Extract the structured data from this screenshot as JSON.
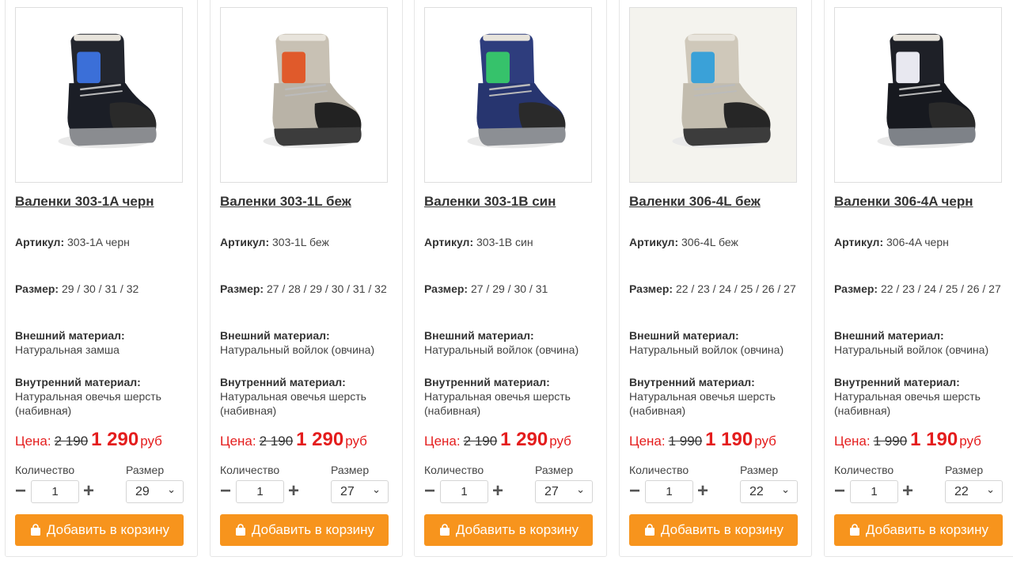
{
  "labels": {
    "article": "Артикул:",
    "size": "Размер:",
    "outer_material": "Внешний материал:",
    "inner_material": "Внутренний материал:",
    "price": "Цена:",
    "currency": "руб",
    "quantity": "Количество",
    "size_select": "Размер",
    "minus": "−",
    "plus": "+",
    "add_to_cart": "Добавить в корзину"
  },
  "colors": {
    "accent": "#f7941d",
    "price": "#e41d1d"
  },
  "products": [
    {
      "title": "Валенки 303-1A черн",
      "article": "303-1A черн",
      "sizes": "29 / 30 / 31 / 32",
      "outer": "Натуральная замша",
      "inner": "Натуральная овечья шерсть (набивная)",
      "old_price": "2 190",
      "new_price": "1 290",
      "qty": "1",
      "selected_size": "29",
      "boot": {
        "body": "#1b1e26",
        "shaft": "#23262e",
        "patch": "#3b6fd8",
        "toe": "#2a2a2a",
        "sole": "#8a8c90",
        "bg": "#ffffff"
      }
    },
    {
      "title": "Валенки 303-1L беж",
      "article": "303-1L беж",
      "sizes": "27 / 28 / 29 / 30 / 31 / 32",
      "outer": "Натуральный войлок (овчина)",
      "inner": "Натуральная овечья шерсть (набивная)",
      "old_price": "2 190",
      "new_price": "1 290",
      "qty": "1",
      "selected_size": "27",
      "boot": {
        "body": "#b9b3a7",
        "shaft": "#c8c1b4",
        "patch": "#e05a2b",
        "toe": "#222222",
        "sole": "#3c3c3c",
        "bg": "#ffffff"
      }
    },
    {
      "title": "Валенки 303-1B син",
      "article": "303-1B син",
      "sizes": "27 / 29 / 30 / 31",
      "outer": "Натуральный войлок (овчина)",
      "inner": "Натуральная овечья шерсть (набивная)",
      "old_price": "2 190",
      "new_price": "1 290",
      "qty": "1",
      "selected_size": "27",
      "boot": {
        "body": "#27356f",
        "shaft": "#2e3d7d",
        "patch": "#36c26b",
        "toe": "#2a2a2a",
        "sole": "#8c8f94",
        "bg": "#ffffff"
      }
    },
    {
      "title": "Валенки 306-4L беж",
      "article": "306-4L беж",
      "sizes": "22 / 23 / 24 / 25 / 26 / 27",
      "outer": "Натуральный войлок (овчина)",
      "inner": "Натуральная овечья шерсть (набивная)",
      "old_price": "1 990",
      "new_price": "1 190",
      "qty": "1",
      "selected_size": "22",
      "boot": {
        "body": "#c2bcae",
        "shaft": "#cfc8ba",
        "patch": "#3aa1d8",
        "toe": "#262626",
        "sole": "#3c3c3c",
        "bg": "#f4f3ee"
      }
    },
    {
      "title": "Валенки 306-4A черн",
      "article": "306-4A черн",
      "sizes": "22 / 23 / 24 / 25 / 26 / 27",
      "outer": "Натуральный войлок (овчина)",
      "inner": "Натуральная овечья шерсть (набивная)",
      "old_price": "1 990",
      "new_price": "1 190",
      "qty": "1",
      "selected_size": "22",
      "boot": {
        "body": "#17191f",
        "shaft": "#1e2027",
        "patch": "#e8e8f0",
        "toe": "#2a2a2a",
        "sole": "#7e8288",
        "bg": "#ffffff"
      }
    }
  ]
}
